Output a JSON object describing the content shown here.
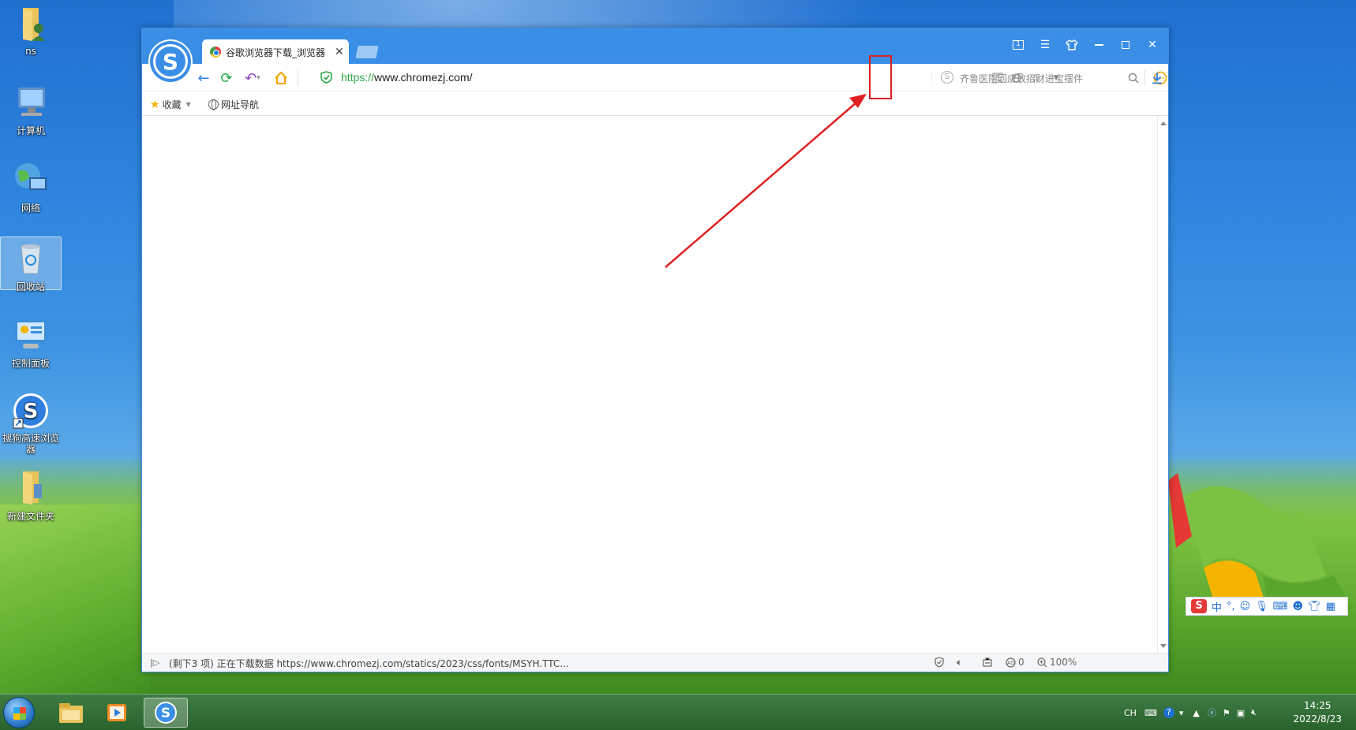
{
  "desktop": {
    "icons": [
      {
        "label": "ns"
      },
      {
        "label": "计算机"
      },
      {
        "label": "网络"
      },
      {
        "label": "回收站"
      },
      {
        "label": "控制面板"
      },
      {
        "label": "搜狗高速浏览器"
      },
      {
        "label": "新建文件夹"
      }
    ]
  },
  "browser": {
    "tab": {
      "title": "谷歌浏览器下载_浏览器"
    },
    "address": {
      "scheme": "https://",
      "rest": "www.chromezj.com/"
    },
    "search": {
      "placeholder": "齐鲁医院回应放招财进宝摆件"
    },
    "bookmarks": [
      {
        "label": "收藏"
      },
      {
        "label": "网址导航"
      }
    ],
    "status": {
      "text": "(剩下3 项) 正在下载数据 https://www.chromezj.com/statics/2023/css/fonts/MSYH.TTC...",
      "adblock_count": "0",
      "zoom": "100%"
    },
    "window_controls": {
      "tab_count": "1"
    }
  },
  "ime": {
    "mode": "中",
    "punct": "°,"
  },
  "taskbar": {
    "tray": {
      "lang": "CH"
    },
    "clock": {
      "time": "14:25",
      "date": "2022/8/23"
    }
  },
  "colors": {
    "accent": "#3a8ee6",
    "annotation": "#e02020"
  }
}
